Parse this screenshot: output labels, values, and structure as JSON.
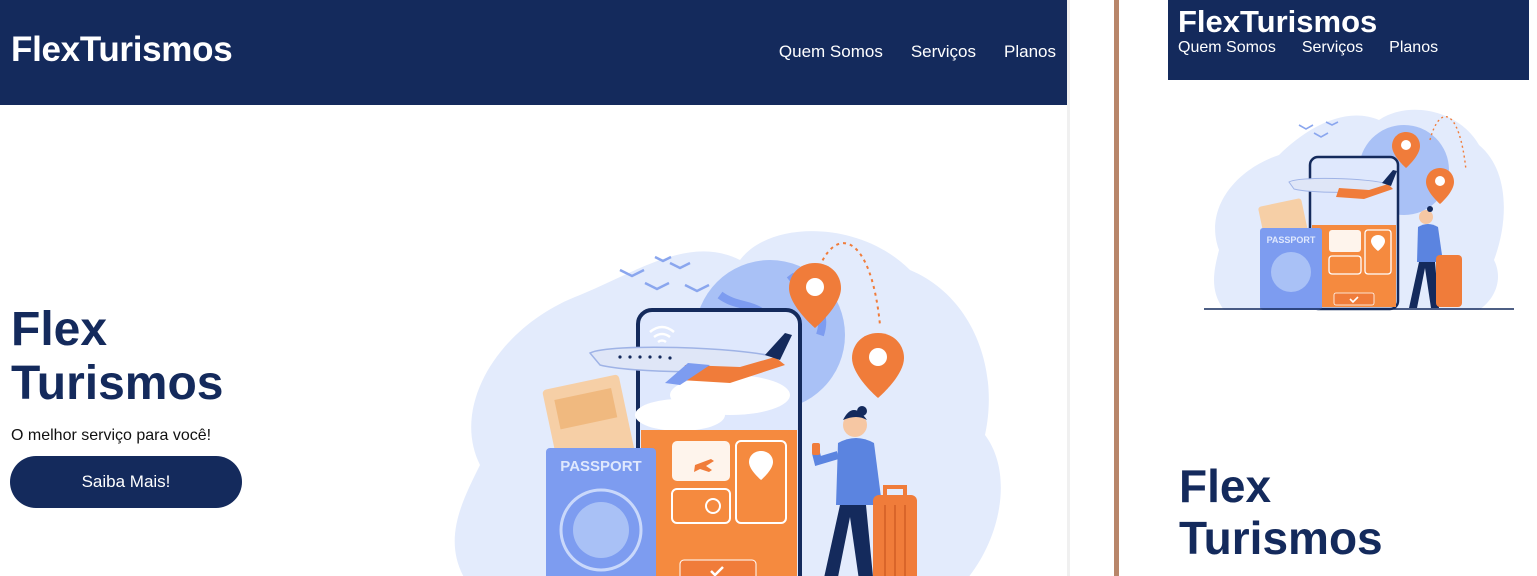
{
  "desktop": {
    "brand": "FlexTurismos",
    "nav_links": [
      "Quem Somos",
      "Serviços",
      "Planos"
    ],
    "hero": {
      "title_line1": "Flex",
      "title_line2": "Turismos",
      "subtitle": "O melhor serviço para você!",
      "cta_label": "Saiba Mais!"
    },
    "illustration": {
      "passport_label": "PASSPORT"
    }
  },
  "mobile": {
    "brand": "FlexTurismos",
    "nav_links": [
      "Quem Somos",
      "Serviços",
      "Planos"
    ],
    "hero": {
      "title_line1": "Flex",
      "title_line2": "Turismos"
    },
    "illustration": {
      "passport_label": "PASSPORT"
    }
  },
  "colors": {
    "navy": "#142a5c",
    "orange": "#f07c3a",
    "blue": "#7d9cf0",
    "light_blue": "#c9d8fb",
    "divider": "#b8866a"
  },
  "icons": [
    "airplane-icon",
    "map-pin-icon",
    "wifi-icon",
    "globe-icon",
    "checkmark-icon",
    "clock-icon"
  ]
}
